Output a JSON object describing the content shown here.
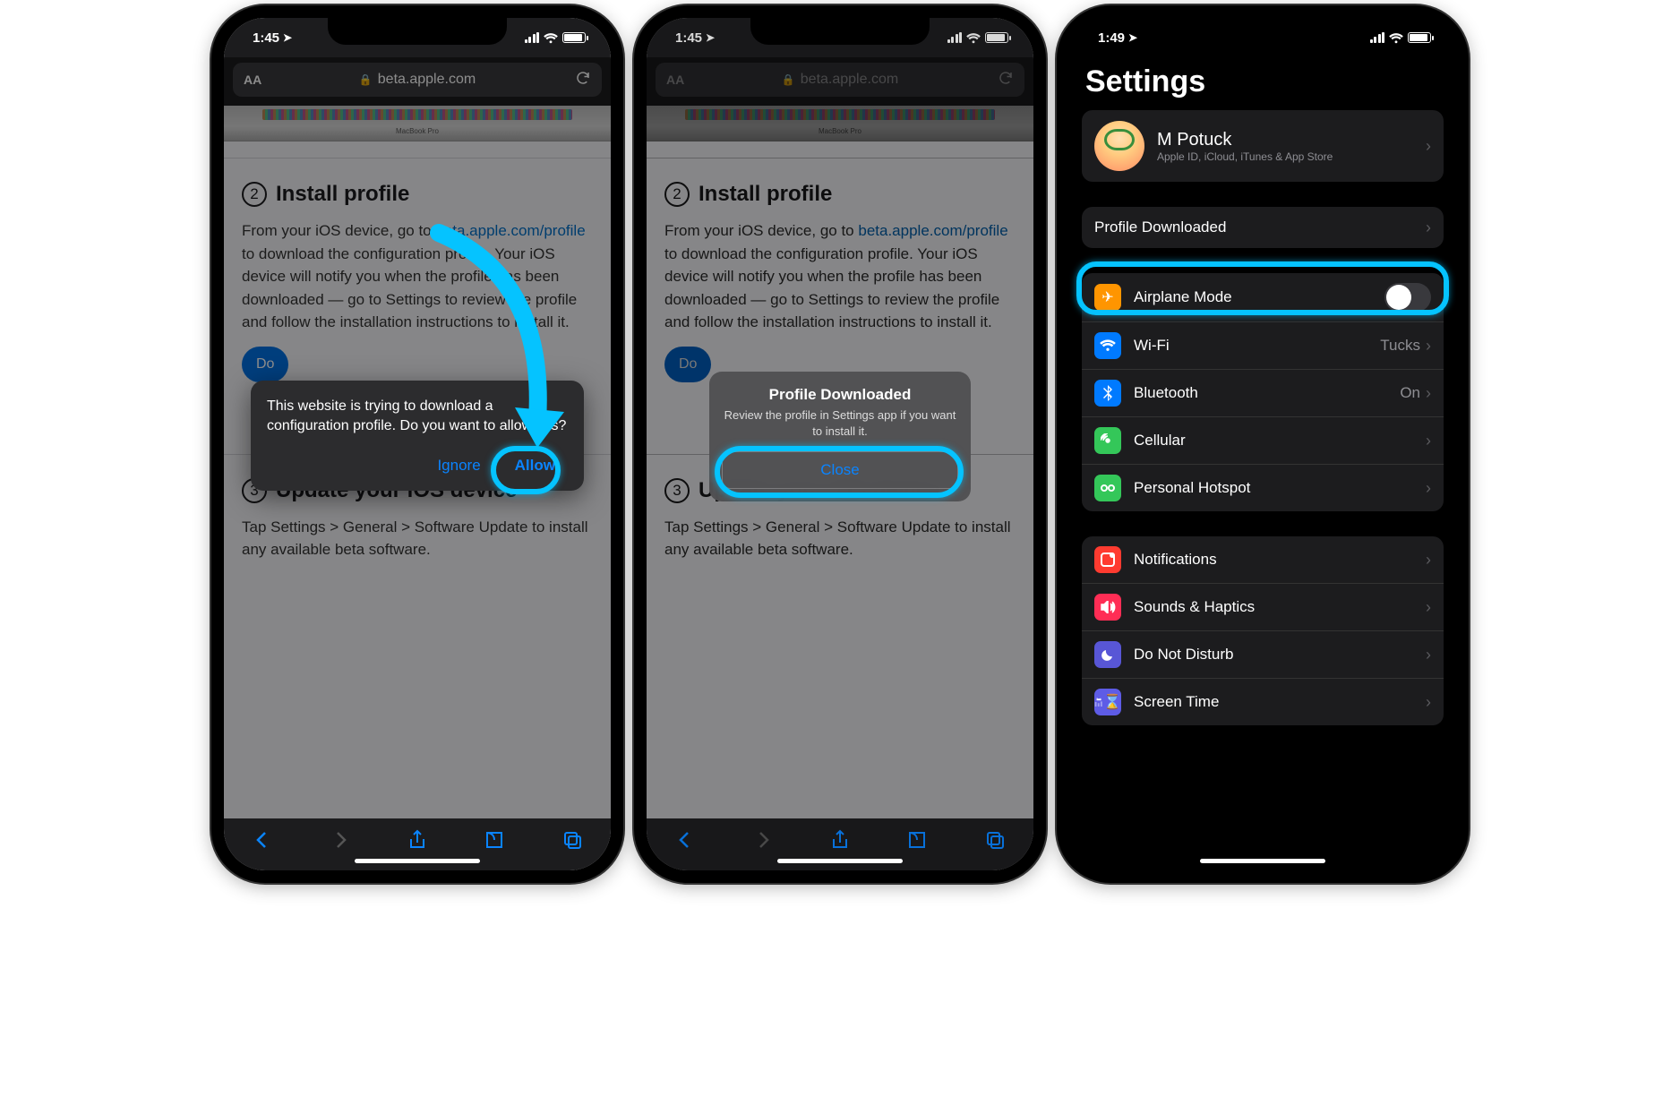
{
  "status": {
    "time_left": "1:45",
    "time_right": "1:49"
  },
  "safari": {
    "aa": "AA",
    "domain": "beta.apple.com",
    "macbook_label": "MacBook Pro"
  },
  "page": {
    "step2_title": "Install profile",
    "step2_body_a": "From your iOS device, go to ",
    "step2_link": "beta.apple.com/profile",
    "step2_body_b": " to download the configuration profile. Your iOS device will notify you when the profile has been downloaded — go to Settings to review the profile and follow the installation instructions to install it.",
    "download_btn": "Download profile",
    "step3_title": "Update your iOS device",
    "step3_body": "Tap Settings > General > Software Update to install any available beta software."
  },
  "popup1": {
    "text": "This website is trying to download a configuration profile. Do you want to allow this?",
    "ignore": "Ignore",
    "allow": "Allow"
  },
  "popup2": {
    "title": "Profile Downloaded",
    "text": "Review the profile in Settings app if you want to install it.",
    "close": "Close"
  },
  "settings": {
    "title": "Settings",
    "profile_name": "M Potuck",
    "profile_sub": "Apple ID, iCloud, iTunes & App Store",
    "profile_downloaded": "Profile Downloaded",
    "airplane": "Airplane Mode",
    "wifi": "Wi-Fi",
    "wifi_val": "Tucks",
    "bluetooth": "Bluetooth",
    "bluetooth_val": "On",
    "cellular": "Cellular",
    "hotspot": "Personal Hotspot",
    "notifications": "Notifications",
    "sounds": "Sounds & Haptics",
    "dnd": "Do Not Disturb",
    "screentime": "Screen Time"
  }
}
